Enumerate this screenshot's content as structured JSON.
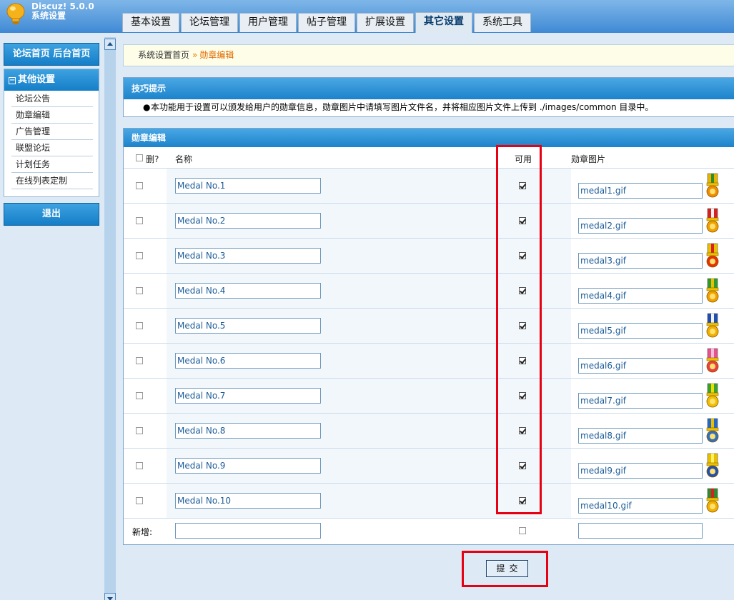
{
  "app": {
    "name": "Discuz! 5.0.0",
    "subtitle": "系统设置"
  },
  "tabs": [
    {
      "label": "基本设置",
      "active": false
    },
    {
      "label": "论坛管理",
      "active": false
    },
    {
      "label": "用户管理",
      "active": false
    },
    {
      "label": "帖子管理",
      "active": false
    },
    {
      "label": "扩展设置",
      "active": false
    },
    {
      "label": "其它设置",
      "active": true
    },
    {
      "label": "系统工具",
      "active": false
    }
  ],
  "sidebar": {
    "top_links": "论坛首页 后台首页",
    "section_title": "其他设置",
    "items": [
      "论坛公告",
      "勋章编辑",
      "广告管理",
      "联盟论坛",
      "计划任务",
      "在线列表定制"
    ],
    "logout": "退出"
  },
  "breadcrumb": {
    "root": "系统设置首页",
    "separator": "»",
    "current": "勋章编辑"
  },
  "tips": {
    "title": "技巧提示",
    "bullet": "●",
    "text": "本功能用于设置可以颁发给用户的勋章信息，勋章图片中请填写图片文件名，并将相应图片文件上传到 ./images/common 目录中。"
  },
  "medals": {
    "title": "勋章编辑",
    "columns": {
      "delete": "删?",
      "name": "名称",
      "available": "可用",
      "image": "勋章图片"
    },
    "rows": [
      {
        "name": "Medal No.1",
        "available": true,
        "image": "medal1.gif"
      },
      {
        "name": "Medal No.2",
        "available": true,
        "image": "medal2.gif"
      },
      {
        "name": "Medal No.3",
        "available": true,
        "image": "medal3.gif"
      },
      {
        "name": "Medal No.4",
        "available": true,
        "image": "medal4.gif"
      },
      {
        "name": "Medal No.5",
        "available": true,
        "image": "medal5.gif"
      },
      {
        "name": "Medal No.6",
        "available": true,
        "image": "medal6.gif"
      },
      {
        "name": "Medal No.7",
        "available": true,
        "image": "medal7.gif"
      },
      {
        "name": "Medal No.8",
        "available": true,
        "image": "medal8.gif"
      },
      {
        "name": "Medal No.9",
        "available": true,
        "image": "medal9.gif"
      },
      {
        "name": "Medal No.10",
        "available": true,
        "image": "medal10.gif"
      }
    ],
    "new_row": {
      "label": "新增:",
      "name": "",
      "image": ""
    },
    "medal_colors": [
      {
        "ribbon": "#e8b400",
        "stripe": "#2e8b2e",
        "medal": "#f08c00"
      },
      {
        "ribbon": "#d82020",
        "stripe": "#f0f0f0",
        "medal": "#f0a000"
      },
      {
        "ribbon": "#e8c000",
        "stripe": "#d82020",
        "medal": "#e83000"
      },
      {
        "ribbon": "#2e9a2e",
        "stripe": "#e8c000",
        "medal": "#f0a000"
      },
      {
        "ribbon": "#1e4fb0",
        "stripe": "#f0f0f0",
        "medal": "#f0b000"
      },
      {
        "ribbon": "#e85090",
        "stripe": "#f0c0d8",
        "medal": "#e84040"
      },
      {
        "ribbon": "#3aa030",
        "stripe": "#e8e000",
        "medal": "#f0c000"
      },
      {
        "ribbon": "#2468c8",
        "stripe": "#e8c000",
        "medal": "#3070c0"
      },
      {
        "ribbon": "#e8c000",
        "stripe": "#fff060",
        "medal": "#2050b0"
      },
      {
        "ribbon": "#2e8b2e",
        "stripe": "#d82020",
        "medal": "#f0b000"
      }
    ]
  },
  "submit_label": "提交",
  "highlight_color": "#e60012"
}
